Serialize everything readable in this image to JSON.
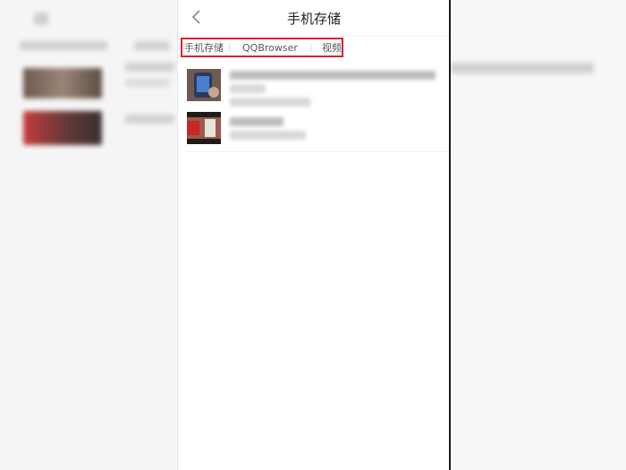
{
  "header": {
    "title": "手机存储"
  },
  "path": {
    "crumbs": [
      "手机存储",
      "QQBrowser",
      "视频"
    ]
  },
  "icons": {
    "back": "chevron-left-icon"
  },
  "colors": {
    "highlight": "#d9232d"
  }
}
